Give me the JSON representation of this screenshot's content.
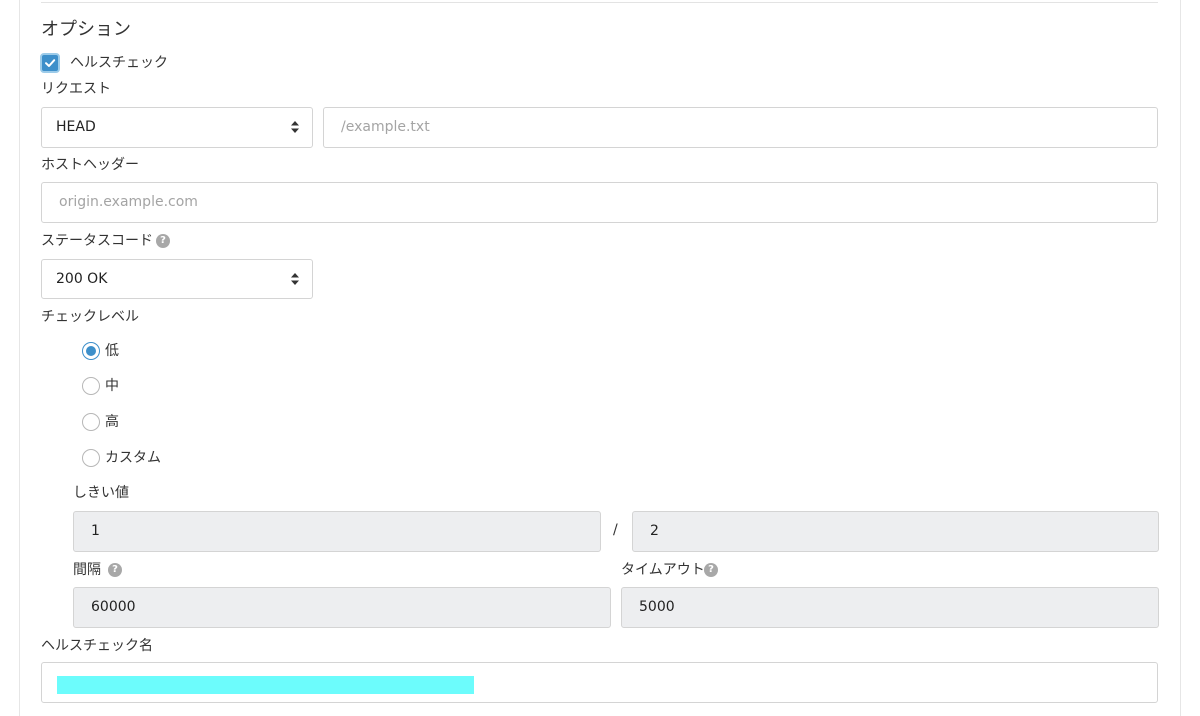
{
  "section_title": "オプション",
  "healthcheck": {
    "label": "ヘルスチェック",
    "checked": true
  },
  "request": {
    "label": "リクエスト",
    "method_value": "HEAD",
    "path_placeholder": "/example.txt"
  },
  "host_header": {
    "label": "ホストヘッダー",
    "placeholder": "origin.example.com"
  },
  "status_code": {
    "label": "ステータスコード",
    "value": "200 OK",
    "help_icon": "question-circle-icon"
  },
  "check_level": {
    "label": "チェックレベル",
    "options": [
      {
        "label": "低",
        "selected": true
      },
      {
        "label": "中",
        "selected": false
      },
      {
        "label": "高",
        "selected": false
      },
      {
        "label": "カスタム",
        "selected": false
      }
    ]
  },
  "threshold": {
    "label": "しきい値",
    "value1": "1",
    "separator": "/",
    "value2": "2"
  },
  "interval": {
    "label": "間隔",
    "value": "60000",
    "help_icon": "question-circle-icon"
  },
  "timeout": {
    "label": "タイムアウト",
    "value": "5000",
    "help_icon": "question-circle-icon"
  },
  "healthcheck_name": {
    "label": "ヘルスチェック名",
    "value_redacted": true
  },
  "colors": {
    "accent": "#3d8fca",
    "disabled_bg": "#edeef0",
    "redaction": "#6cfcfc"
  }
}
